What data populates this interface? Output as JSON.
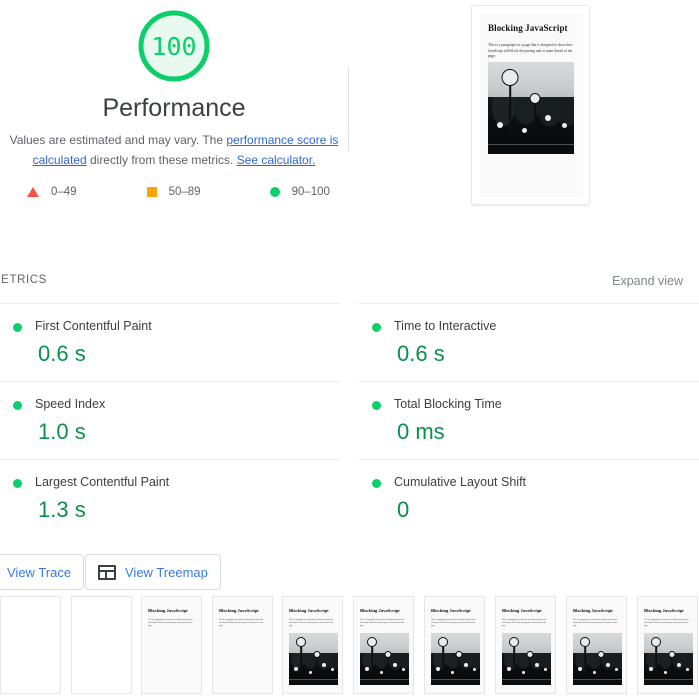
{
  "score": {
    "value": "100",
    "title": "Performance",
    "ring_color": "#0cce6b",
    "fill_color": "#e8faf0",
    "text_color": "#0cce6b",
    "description_pre": "Values are estimated and may vary. The ",
    "link1": "performance score is calculated",
    "description_mid": " directly from these metrics. ",
    "link2": "See calculator.",
    "legend": [
      {
        "marker": "triangle-marker",
        "label": "0–49",
        "color": "#ff4e42"
      },
      {
        "marker": "square-marker",
        "label": "50–89",
        "color": "#ffa400"
      },
      {
        "marker": "circle-marker",
        "label": "90–100",
        "color": "#0cce6b"
      }
    ]
  },
  "thumbnail": {
    "heading": "Blocking JavaScript",
    "paragraph": "This is a paragraph on a page that is designed to show how JavaScript will block the parsing and or main thread of the page."
  },
  "metrics": {
    "section_label": "METRICS",
    "expand_view_label": "Expand view",
    "left": [
      {
        "name": "First Contentful Paint",
        "value": "0.6 s",
        "status": "pass",
        "status_color": "#0cce6b"
      },
      {
        "name": "Speed Index",
        "value": "1.0 s",
        "status": "pass",
        "status_color": "#0cce6b"
      },
      {
        "name": "Largest Contentful Paint",
        "value": "1.3 s",
        "status": "pass",
        "status_color": "#0cce6b"
      }
    ],
    "right": [
      {
        "name": "Time to Interactive",
        "value": "0.6 s",
        "status": "pass",
        "status_color": "#0cce6b"
      },
      {
        "name": "Total Blocking Time",
        "value": "0 ms",
        "status": "pass",
        "status_color": "#0cce6b"
      },
      {
        "name": "Cumulative Layout Shift",
        "value": "0",
        "status": "pass",
        "status_color": "#0cce6b"
      }
    ]
  },
  "actions": {
    "view_trace_label": "View Trace",
    "view_treemap_label": "View Treemap",
    "treemap_icon": "treemap-icon"
  },
  "filmstrip": {
    "heading": "Blocking JavaScript",
    "paragraph": "This is a paragraph on a page that is designed to show how JavaScript will block the parsing and or main thread of the page.",
    "frames": [
      {
        "state": "blank",
        "shaded": false,
        "has_text": false,
        "has_photo": false
      },
      {
        "state": "blank",
        "shaded": false,
        "has_text": false,
        "has_photo": false
      },
      {
        "state": "text-only",
        "shaded": true,
        "has_text": true,
        "has_photo": false
      },
      {
        "state": "text-only",
        "shaded": true,
        "has_text": true,
        "has_photo": false
      },
      {
        "state": "full",
        "shaded": true,
        "has_text": true,
        "has_photo": true
      },
      {
        "state": "full",
        "shaded": true,
        "has_text": true,
        "has_photo": true
      },
      {
        "state": "full",
        "shaded": true,
        "has_text": true,
        "has_photo": true
      },
      {
        "state": "full",
        "shaded": true,
        "has_text": true,
        "has_photo": true
      },
      {
        "state": "full",
        "shaded": true,
        "has_text": true,
        "has_photo": true
      },
      {
        "state": "full",
        "shaded": true,
        "has_text": true,
        "has_photo": true
      }
    ]
  }
}
